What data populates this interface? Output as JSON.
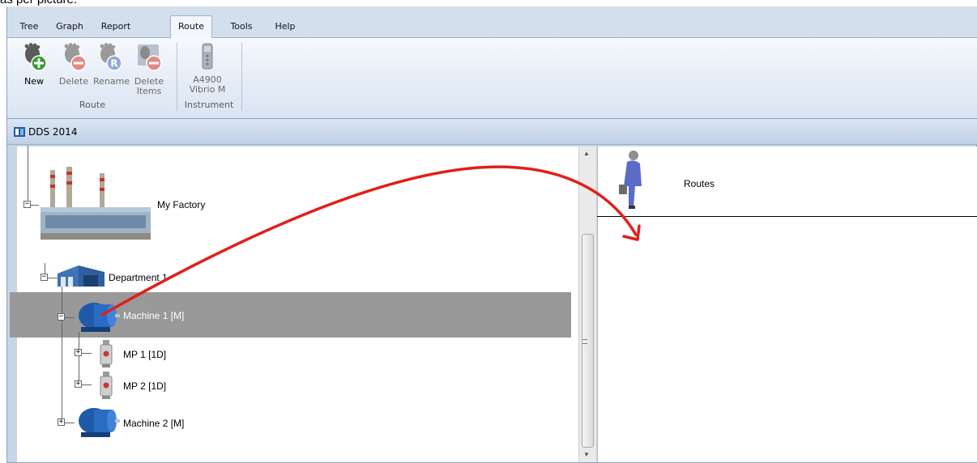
{
  "caption": "as per picture.",
  "menu": {
    "tabs": [
      {
        "label": "Tree"
      },
      {
        "label": "Graph"
      },
      {
        "label": "Report"
      },
      {
        "label": "Route"
      },
      {
        "label": "Tools"
      },
      {
        "label": "Help"
      }
    ],
    "active_tab": "Route"
  },
  "ribbon": {
    "route_group": {
      "label": "Route",
      "buttons": [
        {
          "label": "New",
          "icon": "footprint-add-icon",
          "enabled": true
        },
        {
          "label": "Delete",
          "icon": "footprint-delete-icon",
          "enabled": false
        },
        {
          "label": "Rename",
          "icon": "footprint-rename-icon",
          "enabled": false
        },
        {
          "label_line1": "Delete",
          "label_line2": "Items",
          "icon": "delete-items-icon",
          "enabled": false
        }
      ]
    },
    "instrument_group": {
      "label": "Instrument",
      "button": {
        "label_line1": "A4900",
        "label_line2": "Vibrio M",
        "icon": "vibrometer-device-icon",
        "enabled": false
      }
    }
  },
  "document": {
    "title": "DDS 2014"
  },
  "tree": {
    "nodes": [
      {
        "label": "My Factory",
        "icon": "factory-icon",
        "level": 0,
        "expanded": true
      },
      {
        "label": "Department 1",
        "icon": "warehouse-building-icon",
        "level": 1,
        "expanded": true
      },
      {
        "label": "Machine 1 [M]",
        "icon": "electric-motor-icon",
        "level": 2,
        "expanded": true,
        "selected": true
      },
      {
        "label": "MP 1 [1D]",
        "icon": "vibration-sensor-icon",
        "level": 3,
        "expanded": false
      },
      {
        "label": "MP 2 [1D]",
        "icon": "vibration-sensor-icon",
        "level": 3,
        "expanded": false
      },
      {
        "label": "Machine 2 [M]",
        "icon": "electric-motor-icon",
        "level": 2,
        "expanded": false
      }
    ]
  },
  "routes_panel": {
    "label": "Routes",
    "icon": "walking-worker-icon"
  },
  "colors": {
    "selection": "#999999",
    "annotation_arrow": "#e0201a",
    "ribbon_bg": "#dfe8f4"
  }
}
